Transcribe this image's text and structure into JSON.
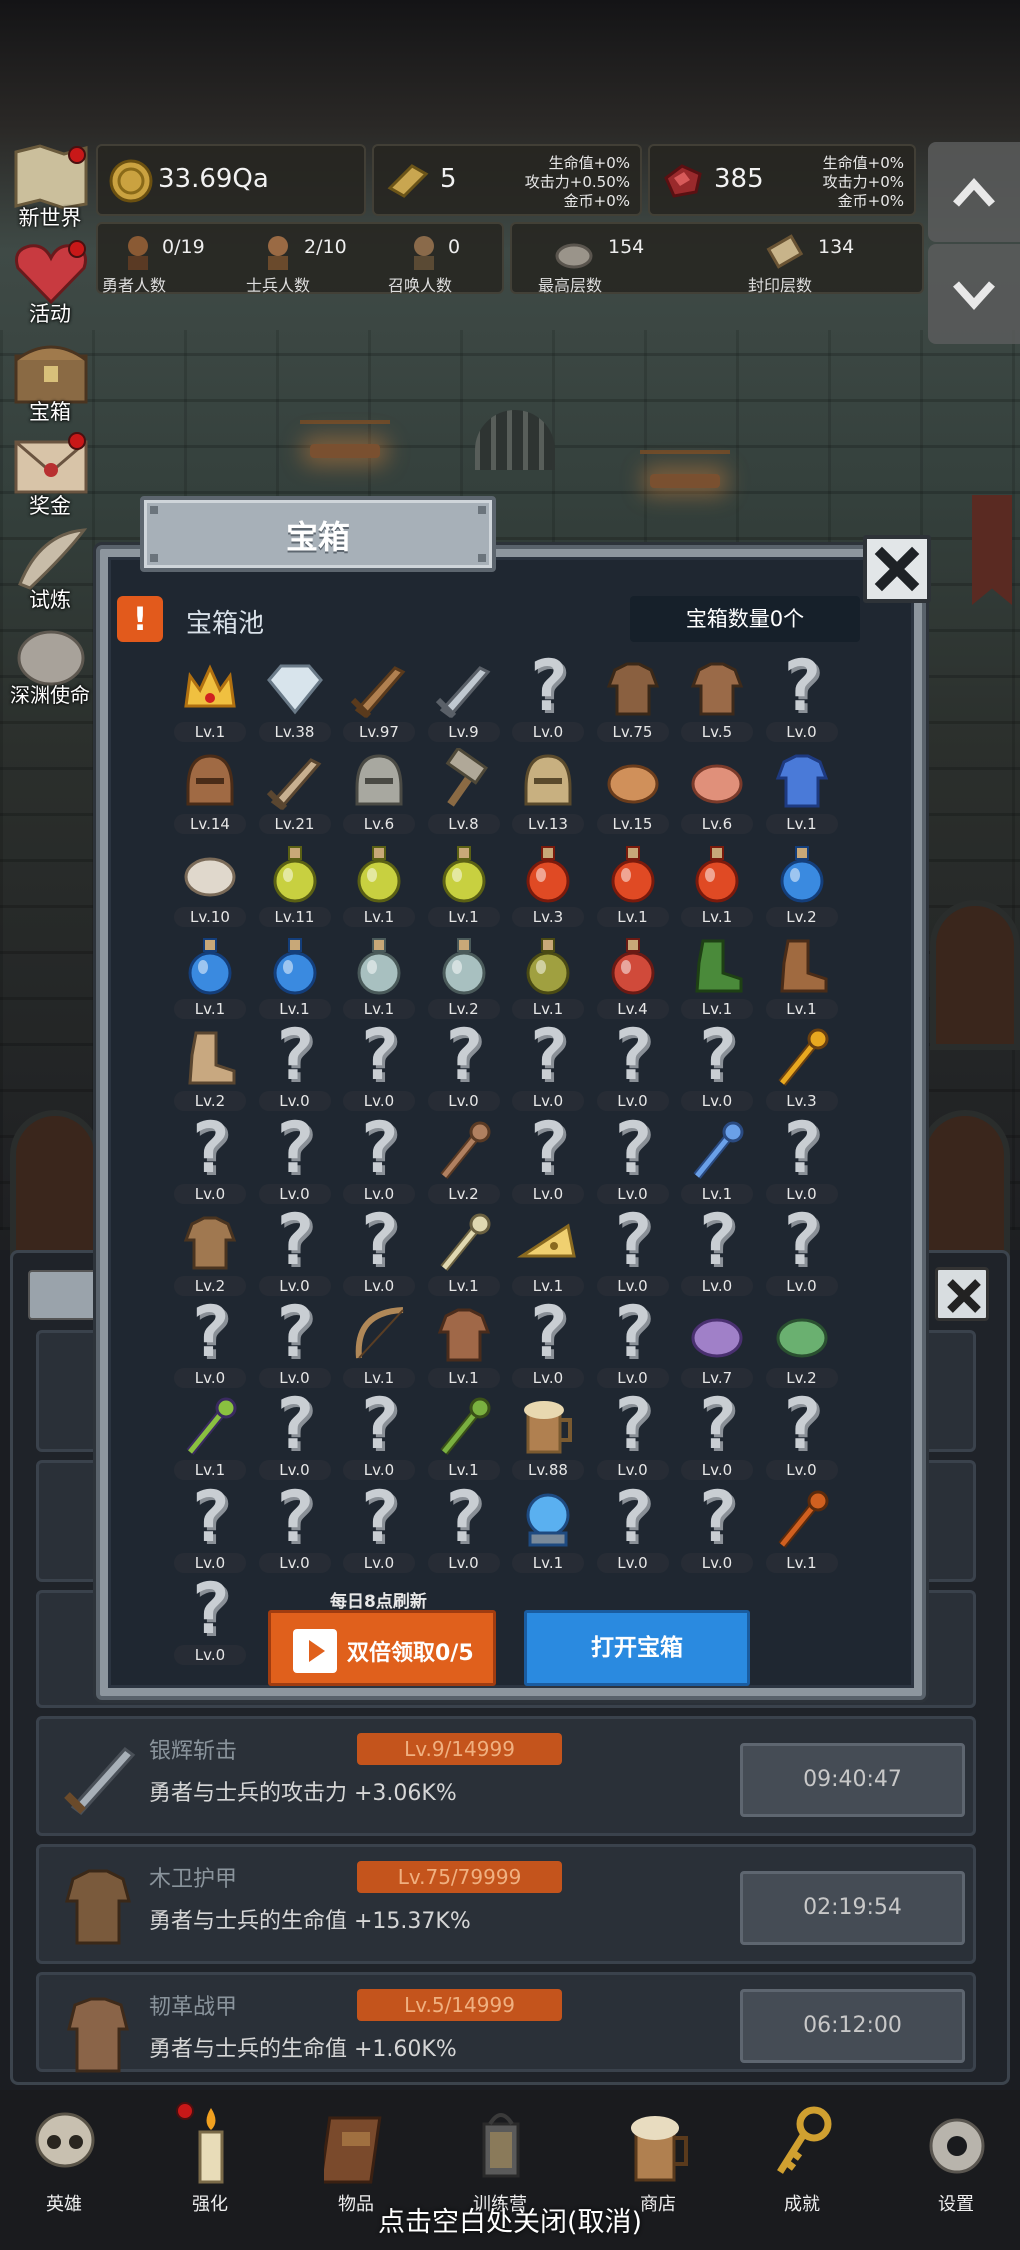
{
  "resources": [
    {
      "icon": "gold-coin-icon",
      "value": "33.69Qa",
      "bonus": []
    },
    {
      "icon": "gold-bar-icon",
      "value": "5",
      "bonus": [
        "生命值+0%",
        "攻击力+0.50%",
        "金币+0%"
      ]
    },
    {
      "icon": "red-gem-icon",
      "value": "385",
      "bonus": [
        "生命值+0%",
        "攻击力+0%",
        "金币+0%"
      ]
    }
  ],
  "counters": [
    {
      "icon": "hero-icon",
      "value": "0/19",
      "label": "勇者人数"
    },
    {
      "icon": "soldier-icon",
      "value": "2/10",
      "label": "士兵人数"
    },
    {
      "icon": "summon-icon",
      "value": "0",
      "label": "召唤人数"
    },
    {
      "icon": "stone-icon",
      "value": "154",
      "label": "最高层数"
    },
    {
      "icon": "scroll-icon",
      "value": "134",
      "label": "封印层数"
    }
  ],
  "side_menu": [
    {
      "label": "新世界",
      "dot": true
    },
    {
      "label": "活动",
      "dot": true
    },
    {
      "label": "宝箱",
      "dot": false
    },
    {
      "label": "奖金",
      "dot": true
    },
    {
      "label": "试炼",
      "dot": false
    },
    {
      "label": "深渊使命",
      "dot": false
    }
  ],
  "modal": {
    "title": "宝箱",
    "pool_badge": "!",
    "pool_title": "宝箱池",
    "chest_count": "宝箱数量0个",
    "refresh_note": "每日8点刷新",
    "double_label": "双倍领取0/5",
    "open_label": "打开宝箱"
  },
  "items": [
    {
      "icon": "crown-icon",
      "lv": "Lv.1"
    },
    {
      "icon": "diamond-icon",
      "lv": "Lv.38"
    },
    {
      "icon": "wooden-sword-icon",
      "lv": "Lv.97"
    },
    {
      "icon": "silver-sword-icon",
      "lv": "Lv.9"
    },
    {
      "icon": "unknown",
      "lv": "Lv.0"
    },
    {
      "icon": "wood-armor-icon",
      "lv": "Lv.75"
    },
    {
      "icon": "leather-armor-icon",
      "lv": "Lv.5"
    },
    {
      "icon": "unknown",
      "lv": "Lv.0"
    },
    {
      "icon": "leather-helmet-icon",
      "lv": "Lv.14"
    },
    {
      "icon": "dagger-icon",
      "lv": "Lv.21"
    },
    {
      "icon": "knight-helmet-icon",
      "lv": "Lv.6"
    },
    {
      "icon": "hammer-icon",
      "lv": "Lv.8"
    },
    {
      "icon": "gold-helmet-icon",
      "lv": "Lv.13"
    },
    {
      "icon": "meat-icon",
      "lv": "Lv.15"
    },
    {
      "icon": "steak-icon",
      "lv": "Lv.6"
    },
    {
      "icon": "blue-pouch-icon",
      "lv": "Lv.1"
    },
    {
      "icon": "bread-icon",
      "lv": "Lv.10"
    },
    {
      "icon": "yellow-potion-icon",
      "lv": "Lv.11"
    },
    {
      "icon": "yellow-potion-icon",
      "lv": "Lv.1"
    },
    {
      "icon": "yellow-potion-icon",
      "lv": "Lv.1"
    },
    {
      "icon": "red-potion-icon",
      "lv": "Lv.3"
    },
    {
      "icon": "red-potion-icon",
      "lv": "Lv.1"
    },
    {
      "icon": "red-potion-icon",
      "lv": "Lv.1"
    },
    {
      "icon": "blue-potion-icon",
      "lv": "Lv.2"
    },
    {
      "icon": "blue-potion-icon",
      "lv": "Lv.1"
    },
    {
      "icon": "blue-potion-icon",
      "lv": "Lv.1"
    },
    {
      "icon": "grey-potion-icon",
      "lv": "Lv.1"
    },
    {
      "icon": "grey-potion-icon",
      "lv": "Lv.2"
    },
    {
      "icon": "olive-bottle-icon",
      "lv": "Lv.1"
    },
    {
      "icon": "red-bottle-icon",
      "lv": "Lv.4"
    },
    {
      "icon": "winged-boot-icon",
      "lv": "Lv.1"
    },
    {
      "icon": "brown-boot-icon",
      "lv": "Lv.1"
    },
    {
      "icon": "leather-boot-icon",
      "lv": "Lv.2"
    },
    {
      "icon": "unknown",
      "lv": "Lv.0"
    },
    {
      "icon": "unknown",
      "lv": "Lv.0"
    },
    {
      "icon": "unknown",
      "lv": "Lv.0"
    },
    {
      "icon": "unknown",
      "lv": "Lv.0"
    },
    {
      "icon": "unknown",
      "lv": "Lv.0"
    },
    {
      "icon": "unknown",
      "lv": "Lv.0"
    },
    {
      "icon": "torch-staff-icon",
      "lv": "Lv.3"
    },
    {
      "icon": "unknown",
      "lv": "Lv.0"
    },
    {
      "icon": "unknown",
      "lv": "Lv.0"
    },
    {
      "icon": "unknown",
      "lv": "Lv.0"
    },
    {
      "icon": "crook-staff-icon",
      "lv": "Lv.2"
    },
    {
      "icon": "unknown",
      "lv": "Lv.0"
    },
    {
      "icon": "unknown",
      "lv": "Lv.0"
    },
    {
      "icon": "blue-orb-wand-icon",
      "lv": "Lv.1"
    },
    {
      "icon": "unknown",
      "lv": "Lv.0"
    },
    {
      "icon": "backpack-icon",
      "lv": "Lv.2"
    },
    {
      "icon": "unknown",
      "lv": "Lv.0"
    },
    {
      "icon": "unknown",
      "lv": "Lv.0"
    },
    {
      "icon": "bone-club-icon",
      "lv": "Lv.1"
    },
    {
      "icon": "cheese-icon",
      "lv": "Lv.1"
    },
    {
      "icon": "unknown",
      "lv": "Lv.0"
    },
    {
      "icon": "unknown",
      "lv": "Lv.0"
    },
    {
      "icon": "unknown",
      "lv": "Lv.0"
    },
    {
      "icon": "unknown",
      "lv": "Lv.0"
    },
    {
      "icon": "unknown",
      "lv": "Lv.0"
    },
    {
      "icon": "bow-icon",
      "lv": "Lv.1"
    },
    {
      "icon": "quiver-icon",
      "lv": "Lv.1"
    },
    {
      "icon": "unknown",
      "lv": "Lv.0"
    },
    {
      "icon": "unknown",
      "lv": "Lv.0"
    },
    {
      "icon": "tentacle-monster-icon",
      "lv": "Lv.7"
    },
    {
      "icon": "shield-amulet-icon",
      "lv": "Lv.2"
    },
    {
      "icon": "emerald-scepter-icon",
      "lv": "Lv.1"
    },
    {
      "icon": "unknown",
      "lv": "Lv.0"
    },
    {
      "icon": "unknown",
      "lv": "Lv.0"
    },
    {
      "icon": "green-orb-wand-icon",
      "lv": "Lv.1"
    },
    {
      "icon": "beer-mug-icon",
      "lv": "Lv.88"
    },
    {
      "icon": "unknown",
      "lv": "Lv.0"
    },
    {
      "icon": "unknown",
      "lv": "Lv.0"
    },
    {
      "icon": "unknown",
      "lv": "Lv.0"
    },
    {
      "icon": "unknown",
      "lv": "Lv.0"
    },
    {
      "icon": "unknown",
      "lv": "Lv.0"
    },
    {
      "icon": "unknown",
      "lv": "Lv.0"
    },
    {
      "icon": "unknown",
      "lv": "Lv.0"
    },
    {
      "icon": "crystal-ball-icon",
      "lv": "Lv.1"
    },
    {
      "icon": "unknown",
      "lv": "Lv.0"
    },
    {
      "icon": "unknown",
      "lv": "Lv.0"
    },
    {
      "icon": "fire-rod-icon",
      "lv": "Lv.1"
    },
    {
      "icon": "unknown",
      "lv": "Lv.0"
    }
  ],
  "list": [
    {
      "icon": "silver-sword-icon",
      "name": "银辉斩击",
      "level": "Lv.9/14999",
      "desc": "勇者与士兵的攻击力 +3.06K%",
      "timer": "09:40:47"
    },
    {
      "icon": "wood-armor-icon",
      "name": "木卫护甲",
      "level": "Lv.75/79999",
      "desc": "勇者与士兵的生命值 +15.37K%",
      "timer": "02:19:54"
    },
    {
      "icon": "leather-armor-icon",
      "name": "韧革战甲",
      "level": "Lv.5/14999",
      "desc": "勇者与士兵的生命值 +1.60K%",
      "timer": "06:12:00"
    }
  ],
  "nav": [
    {
      "icon": "skull-icon",
      "label": "英雄",
      "dot": false
    },
    {
      "icon": "candle-icon",
      "label": "强化",
      "dot": true
    },
    {
      "icon": "book-icon",
      "label": "物品",
      "dot": false
    },
    {
      "icon": "lantern-icon",
      "label": "训练营",
      "dot": false
    },
    {
      "icon": "beer-mug-icon",
      "label": "商店",
      "dot": false
    },
    {
      "icon": "key-icon",
      "label": "成就",
      "dot": false
    },
    {
      "icon": "gear-icon",
      "label": "设置",
      "dot": false
    }
  ],
  "close_hint": "点击空白处关闭(取消)"
}
